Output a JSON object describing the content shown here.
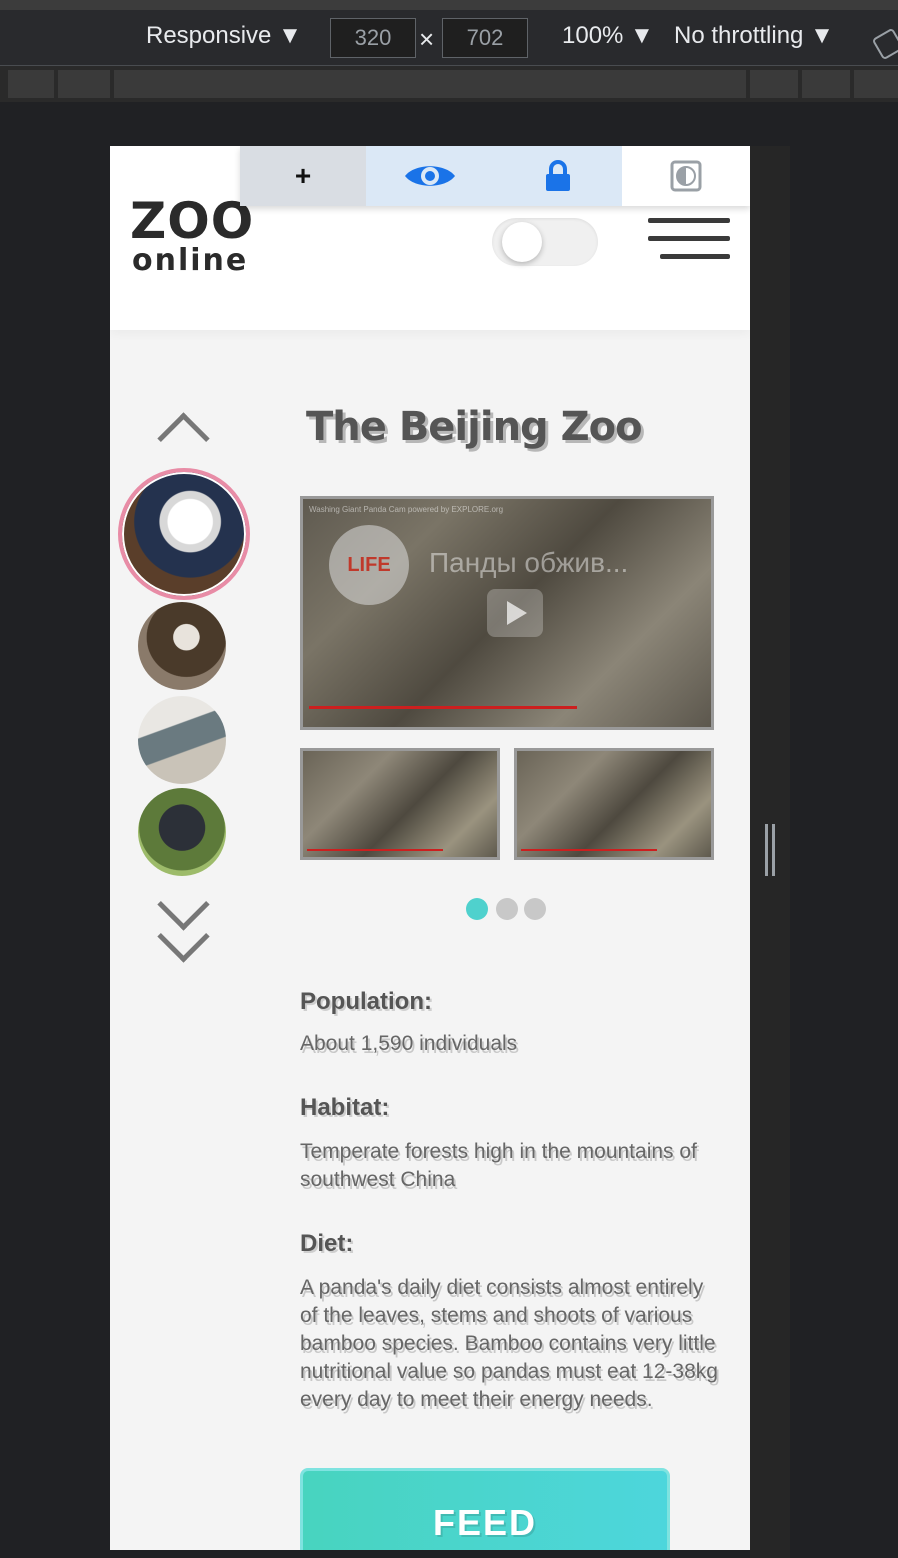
{
  "devtools": {
    "device_mode": "Responsive ▼",
    "width": "320",
    "height": "702",
    "times": "×",
    "zoom": "100% ▼",
    "throttling": "No throttling ▼"
  },
  "extension": {
    "plus_label": "+"
  },
  "header": {
    "logo_line1": "ZOO",
    "logo_line2": "online"
  },
  "main": {
    "title": "The Beijing Zoo",
    "video": {
      "badge": "LIFE",
      "title": "Панды обжив...",
      "caption": "Washing Giant Panda Cam powered by EXPLORE.org"
    },
    "details": [
      {
        "label": "Population:",
        "value": "About 1,590 individuals"
      },
      {
        "label": "Habitat:",
        "value": "Temperate forests high in the mountains of southwest China"
      },
      {
        "label": "Diet:",
        "value": "A panda's daily diet consists almost entirely of the leaves, stems and shoots of various bamboo species. Bamboo contains very little nutritional value so pandas must eat 12-38kg every day to meet their energy needs."
      }
    ],
    "feed_label": "FEED"
  },
  "carousel": {
    "active_dot": 1,
    "dot_count": 3
  },
  "colors": {
    "accent": "#4fd1cd",
    "active_thumb_ring": "#e88ca6",
    "eye_icon": "#1a73e8"
  }
}
